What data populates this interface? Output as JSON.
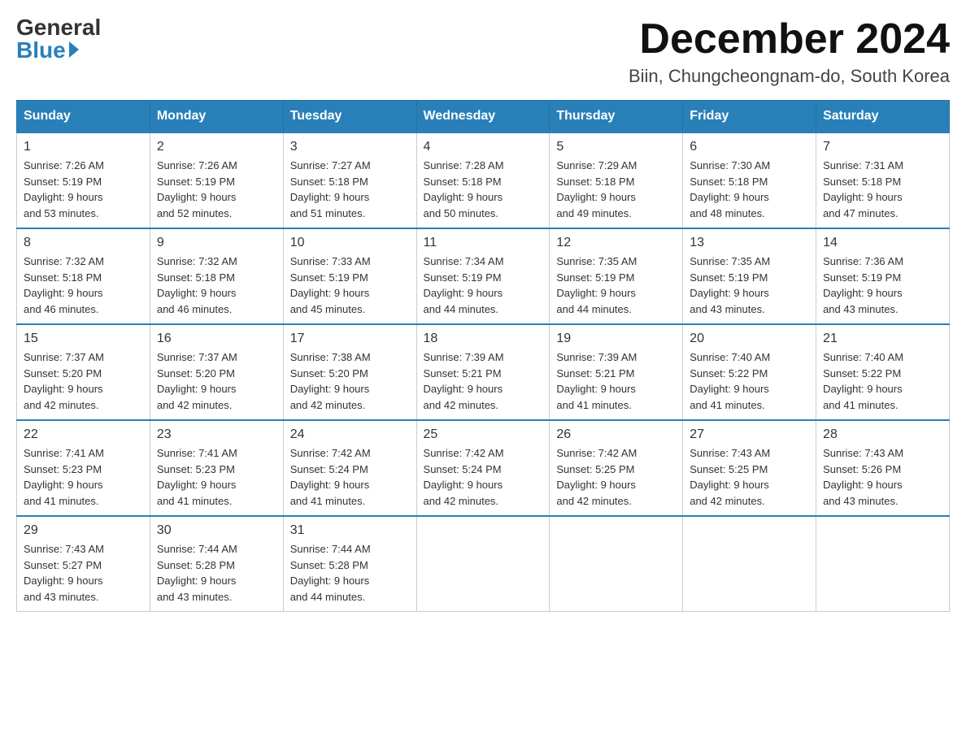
{
  "header": {
    "logo_general": "General",
    "logo_blue": "Blue",
    "month_title": "December 2024",
    "location": "Biin, Chungcheongnam-do, South Korea"
  },
  "days_of_week": [
    "Sunday",
    "Monday",
    "Tuesday",
    "Wednesday",
    "Thursday",
    "Friday",
    "Saturday"
  ],
  "weeks": [
    [
      {
        "num": "1",
        "sunrise": "7:26 AM",
        "sunset": "5:19 PM",
        "daylight": "9 hours and 53 minutes."
      },
      {
        "num": "2",
        "sunrise": "7:26 AM",
        "sunset": "5:19 PM",
        "daylight": "9 hours and 52 minutes."
      },
      {
        "num": "3",
        "sunrise": "7:27 AM",
        "sunset": "5:18 PM",
        "daylight": "9 hours and 51 minutes."
      },
      {
        "num": "4",
        "sunrise": "7:28 AM",
        "sunset": "5:18 PM",
        "daylight": "9 hours and 50 minutes."
      },
      {
        "num": "5",
        "sunrise": "7:29 AM",
        "sunset": "5:18 PM",
        "daylight": "9 hours and 49 minutes."
      },
      {
        "num": "6",
        "sunrise": "7:30 AM",
        "sunset": "5:18 PM",
        "daylight": "9 hours and 48 minutes."
      },
      {
        "num": "7",
        "sunrise": "7:31 AM",
        "sunset": "5:18 PM",
        "daylight": "9 hours and 47 minutes."
      }
    ],
    [
      {
        "num": "8",
        "sunrise": "7:32 AM",
        "sunset": "5:18 PM",
        "daylight": "9 hours and 46 minutes."
      },
      {
        "num": "9",
        "sunrise": "7:32 AM",
        "sunset": "5:18 PM",
        "daylight": "9 hours and 46 minutes."
      },
      {
        "num": "10",
        "sunrise": "7:33 AM",
        "sunset": "5:19 PM",
        "daylight": "9 hours and 45 minutes."
      },
      {
        "num": "11",
        "sunrise": "7:34 AM",
        "sunset": "5:19 PM",
        "daylight": "9 hours and 44 minutes."
      },
      {
        "num": "12",
        "sunrise": "7:35 AM",
        "sunset": "5:19 PM",
        "daylight": "9 hours and 44 minutes."
      },
      {
        "num": "13",
        "sunrise": "7:35 AM",
        "sunset": "5:19 PM",
        "daylight": "9 hours and 43 minutes."
      },
      {
        "num": "14",
        "sunrise": "7:36 AM",
        "sunset": "5:19 PM",
        "daylight": "9 hours and 43 minutes."
      }
    ],
    [
      {
        "num": "15",
        "sunrise": "7:37 AM",
        "sunset": "5:20 PM",
        "daylight": "9 hours and 42 minutes."
      },
      {
        "num": "16",
        "sunrise": "7:37 AM",
        "sunset": "5:20 PM",
        "daylight": "9 hours and 42 minutes."
      },
      {
        "num": "17",
        "sunrise": "7:38 AM",
        "sunset": "5:20 PM",
        "daylight": "9 hours and 42 minutes."
      },
      {
        "num": "18",
        "sunrise": "7:39 AM",
        "sunset": "5:21 PM",
        "daylight": "9 hours and 42 minutes."
      },
      {
        "num": "19",
        "sunrise": "7:39 AM",
        "sunset": "5:21 PM",
        "daylight": "9 hours and 41 minutes."
      },
      {
        "num": "20",
        "sunrise": "7:40 AM",
        "sunset": "5:22 PM",
        "daylight": "9 hours and 41 minutes."
      },
      {
        "num": "21",
        "sunrise": "7:40 AM",
        "sunset": "5:22 PM",
        "daylight": "9 hours and 41 minutes."
      }
    ],
    [
      {
        "num": "22",
        "sunrise": "7:41 AM",
        "sunset": "5:23 PM",
        "daylight": "9 hours and 41 minutes."
      },
      {
        "num": "23",
        "sunrise": "7:41 AM",
        "sunset": "5:23 PM",
        "daylight": "9 hours and 41 minutes."
      },
      {
        "num": "24",
        "sunrise": "7:42 AM",
        "sunset": "5:24 PM",
        "daylight": "9 hours and 41 minutes."
      },
      {
        "num": "25",
        "sunrise": "7:42 AM",
        "sunset": "5:24 PM",
        "daylight": "9 hours and 42 minutes."
      },
      {
        "num": "26",
        "sunrise": "7:42 AM",
        "sunset": "5:25 PM",
        "daylight": "9 hours and 42 minutes."
      },
      {
        "num": "27",
        "sunrise": "7:43 AM",
        "sunset": "5:25 PM",
        "daylight": "9 hours and 42 minutes."
      },
      {
        "num": "28",
        "sunrise": "7:43 AM",
        "sunset": "5:26 PM",
        "daylight": "9 hours and 43 minutes."
      }
    ],
    [
      {
        "num": "29",
        "sunrise": "7:43 AM",
        "sunset": "5:27 PM",
        "daylight": "9 hours and 43 minutes."
      },
      {
        "num": "30",
        "sunrise": "7:44 AM",
        "sunset": "5:28 PM",
        "daylight": "9 hours and 43 minutes."
      },
      {
        "num": "31",
        "sunrise": "7:44 AM",
        "sunset": "5:28 PM",
        "daylight": "9 hours and 44 minutes."
      },
      null,
      null,
      null,
      null
    ]
  ],
  "labels": {
    "sunrise": "Sunrise:",
    "sunset": "Sunset:",
    "daylight": "Daylight:"
  }
}
